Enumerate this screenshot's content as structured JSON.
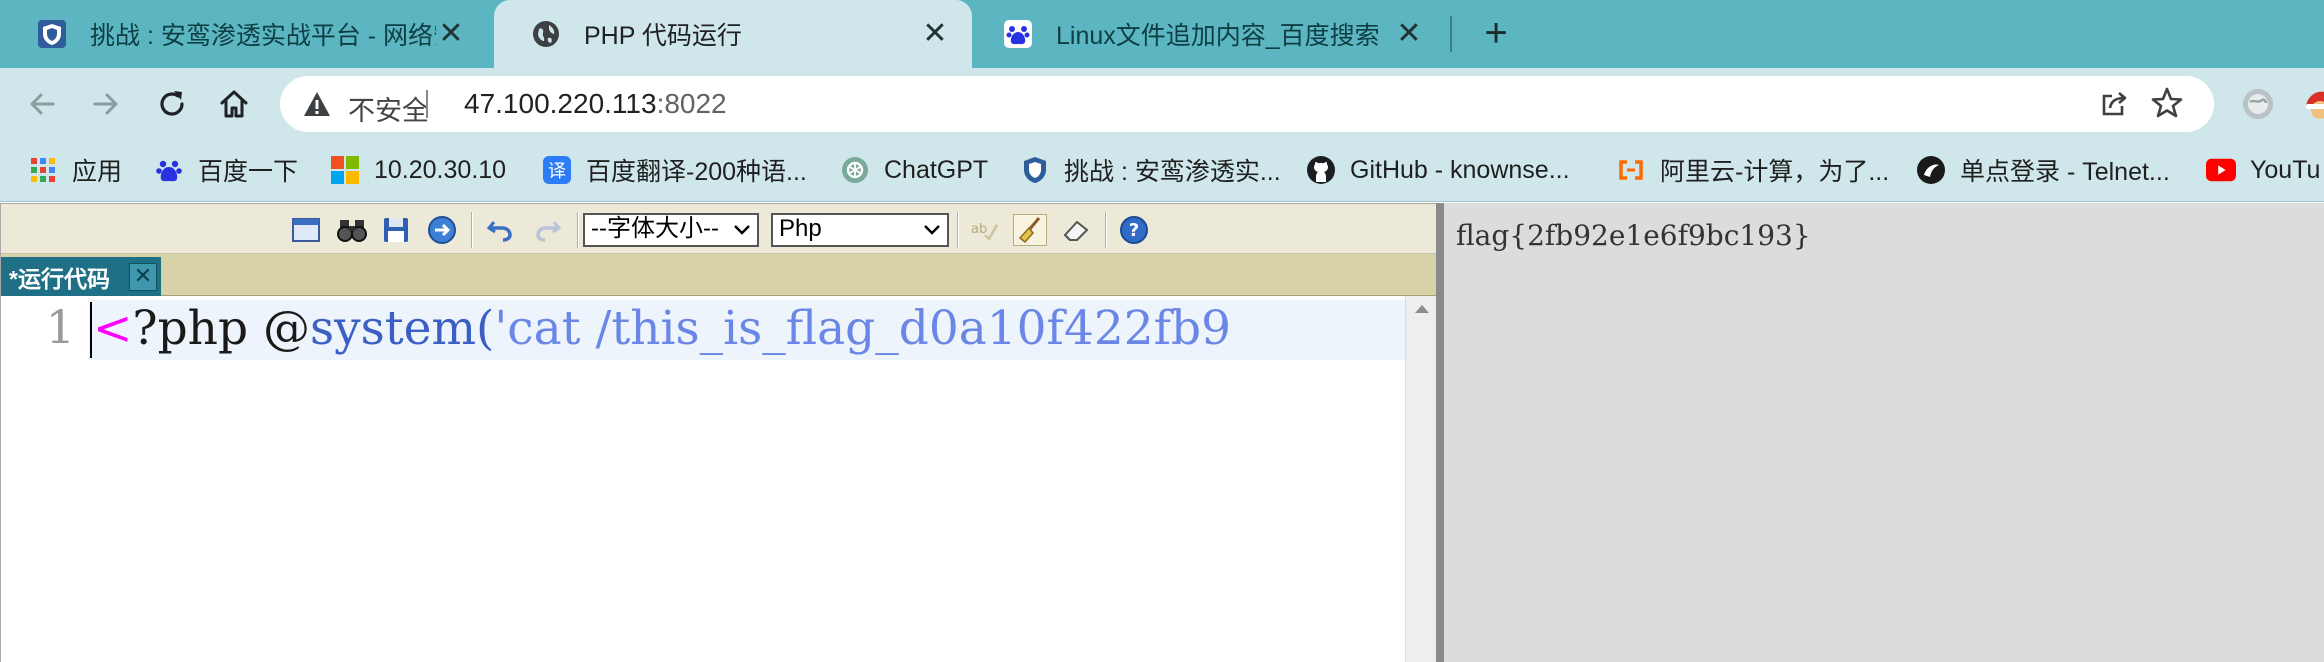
{
  "browser": {
    "tabs": [
      {
        "title": "挑战 : 安鸾渗透实战平台 - 网络安",
        "icon": "shield-icon",
        "active": false
      },
      {
        "title": "PHP 代码运行",
        "icon": "globe-icon",
        "active": true
      },
      {
        "title": "Linux文件追加内容_百度搜索",
        "icon": "baidu-paw-icon",
        "active": false
      }
    ],
    "new_tab_label": "+",
    "close_label": "✕",
    "address_bar": {
      "security_label": "不安全",
      "host": "47.100.220.113",
      "port": ":8022"
    },
    "bookmarks": [
      {
        "label": "应用",
        "icon": "apps-grid-icon"
      },
      {
        "label": "百度一下",
        "icon": "baidu-paw-icon"
      },
      {
        "label": "10.20.30.10",
        "icon": "windows-logo-icon"
      },
      {
        "label": "百度翻译-200种语...",
        "icon": "translate-icon"
      },
      {
        "label": "ChatGPT",
        "icon": "chatgpt-icon"
      },
      {
        "label": "挑战 : 安鸾渗透实...",
        "icon": "shield-icon"
      },
      {
        "label": "GitHub - knownse...",
        "icon": "github-icon"
      },
      {
        "label": "阿里云-计算，为了...",
        "icon": "aliyun-icon"
      },
      {
        "label": "单点登录 - Telnet...",
        "icon": "telnet-icon"
      },
      {
        "label": "YouTu",
        "icon": "youtube-icon"
      }
    ]
  },
  "editor": {
    "toolbar": {
      "font_size_select": "--字体大小--",
      "language_select": "Php"
    },
    "tab_label": "*运行代码",
    "tab_close": "✕",
    "line_number": "1",
    "code": {
      "open_tag": "<",
      "php": "?php ",
      "at": "@",
      "fn": "system(",
      "str": "'cat /this_is_flag_d0a10f422fb9"
    }
  },
  "output": {
    "text": "flag{2fb92e1e6f9bc193}"
  },
  "colors": {
    "tabstrip": "#5bb6c1",
    "toolbar": "#cfe7ea",
    "editor_toolbar": "#ece9d8",
    "editor_tab": "#1f6f86",
    "output_bg": "#dcdcdc"
  }
}
